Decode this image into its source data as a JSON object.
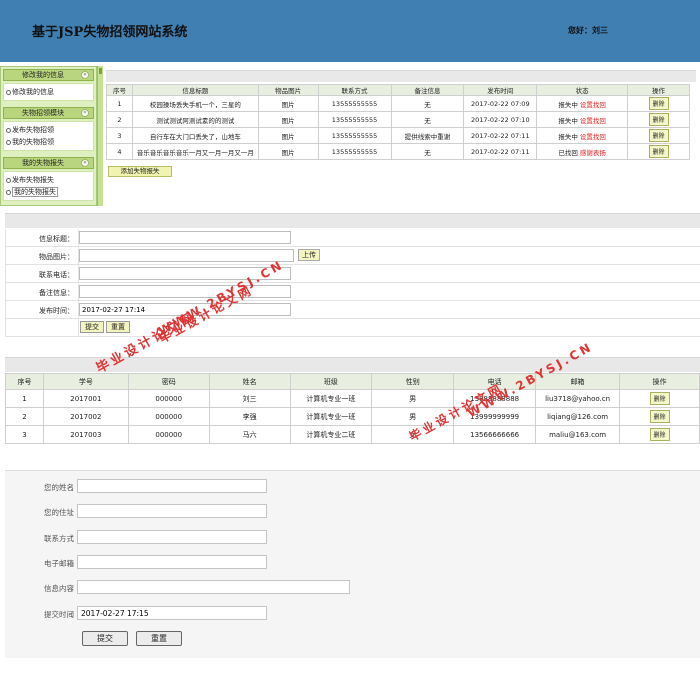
{
  "header": {
    "title": "基于JSP失物招领网站系统",
    "greeting": "您好：刘三"
  },
  "sidebar": {
    "sections": [
      {
        "title": "修改我的信息",
        "items": [
          "修改我的信息"
        ]
      },
      {
        "title": "失物招领模块",
        "items": [
          "发布失物招领",
          "我的失物招领"
        ]
      },
      {
        "title": "我的失物报失",
        "items": [
          "发布失物报失",
          "我的失物报失"
        ]
      }
    ]
  },
  "lost_table": {
    "headers": [
      "序号",
      "信息标题",
      "物品图片",
      "联系方式",
      "备注信息",
      "发布时间",
      "状态",
      "操作"
    ],
    "rows": [
      {
        "id": "1",
        "title": "校园操场丢失手机一个，三星的",
        "img": "图片",
        "contact": "13555555555",
        "note": "无",
        "time": "2017-02-22 07:09",
        "status": "报失中",
        "action": "设置找回",
        "op": "删除"
      },
      {
        "id": "2",
        "title": "测试测试阿测试素的的测试",
        "img": "图片",
        "contact": "13555555555",
        "note": "无",
        "time": "2017-02-22 07:10",
        "status": "报失中",
        "action": "设置找回",
        "op": "删除"
      },
      {
        "id": "3",
        "title": "自行车在大门口丢失了，山地车",
        "img": "图片",
        "contact": "13555555555",
        "note": "提供线索中重谢",
        "time": "2017-02-22 07:11",
        "status": "报失中",
        "action": "设置找回",
        "op": "删除"
      },
      {
        "id": "4",
        "title": "音乐音乐音乐音乐一月又一月一月又一月",
        "img": "图片",
        "contact": "13555555555",
        "note": "无",
        "time": "2017-02-22 07:11",
        "status": "已找回",
        "action": "感谢表扬",
        "op": "删除"
      }
    ],
    "add_button": "添加失物报失"
  },
  "publish_form": {
    "fields": [
      {
        "label": "信息标题：",
        "value": ""
      },
      {
        "label": "物品图片：",
        "value": ""
      },
      {
        "label": "联系电话：",
        "value": ""
      },
      {
        "label": "备注信息：",
        "value": ""
      },
      {
        "label": "发布时间：",
        "value": "2017-02-27 17:14"
      }
    ],
    "upload_label": "上传",
    "submit_label": "提交",
    "reset_label": "重置"
  },
  "user_table": {
    "headers": [
      "序号",
      "学号",
      "密码",
      "姓名",
      "班级",
      "性别",
      "电话",
      "邮箱",
      "操作"
    ],
    "rows": [
      {
        "id": "1",
        "sno": "2017001",
        "pwd": "000000",
        "name": "刘三",
        "cls": "计算机专业一班",
        "sex": "男",
        "phone": "13888888888",
        "email": "liu3718@yahoo.cn",
        "op": "删除"
      },
      {
        "id": "2",
        "sno": "2017002",
        "pwd": "000000",
        "name": "李强",
        "cls": "计算机专业一班",
        "sex": "男",
        "phone": "13999999999",
        "email": "liqiang@126.com",
        "op": "删除"
      },
      {
        "id": "3",
        "sno": "2017003",
        "pwd": "000000",
        "name": "马六",
        "cls": "计算机专业二班",
        "sex": "女",
        "phone": "13566666666",
        "email": "maliu@163.com",
        "op": "删除"
      }
    ]
  },
  "message_form": {
    "fields": [
      {
        "label": "您的姓名",
        "value": ""
      },
      {
        "label": "您的住址",
        "value": ""
      },
      {
        "label": "联系方式",
        "value": ""
      },
      {
        "label": "电子邮箱",
        "value": ""
      },
      {
        "label": "信息内容",
        "value": ""
      },
      {
        "label": "提交时间",
        "value": "2017-02-27 17:15"
      }
    ],
    "submit_label": "提交",
    "reset_label": "重置"
  },
  "watermarks": {
    "text1": "毕业设计论文网",
    "text2": "WWW.2BYSJ.CN"
  },
  "colors": {
    "header": "#3f7fb2",
    "sidebar": "#dff0c0",
    "alert": "#e02020"
  }
}
